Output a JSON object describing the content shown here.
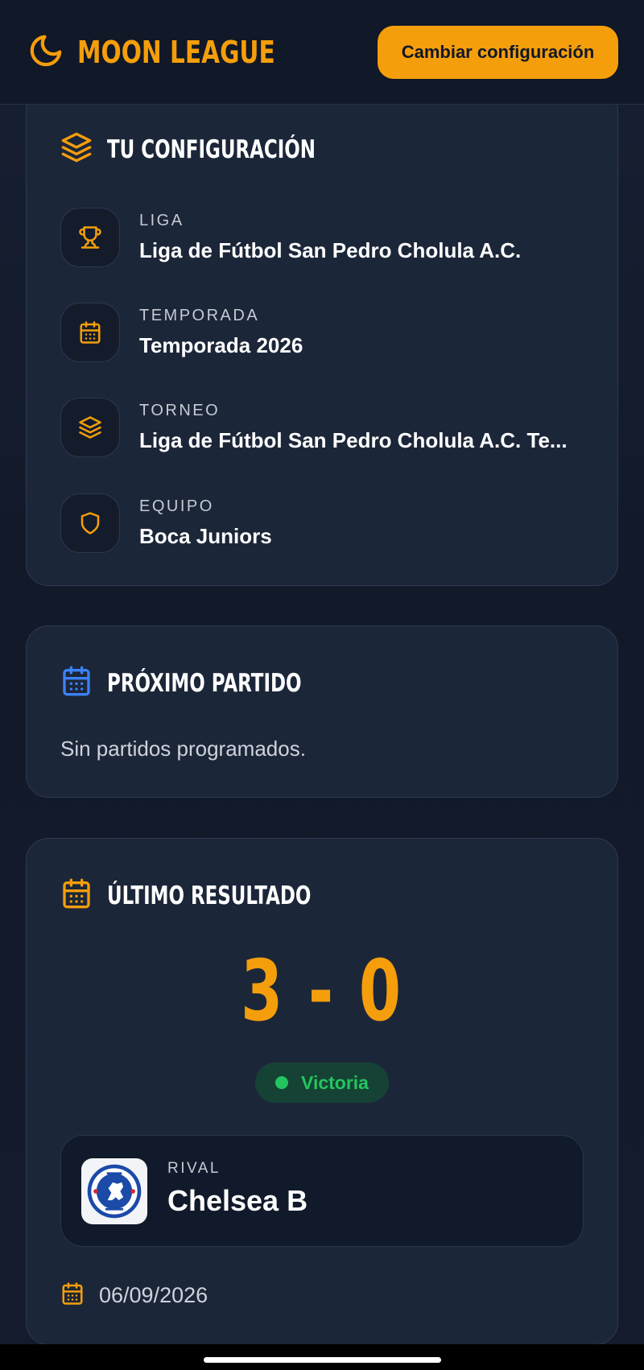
{
  "header": {
    "brand": "MOON LEAGUE",
    "config_button": "Cambiar configuración",
    "brand_icon": "moon-icon"
  },
  "config_card": {
    "title": "TU CONFIGURACIÓN",
    "title_icon": "layers-icon",
    "rows": [
      {
        "label": "LIGA",
        "value": "Liga de Fútbol San Pedro Cholula A.C.",
        "icon": "trophy-icon"
      },
      {
        "label": "TEMPORADA",
        "value": "Temporada 2026",
        "icon": "calendar-icon"
      },
      {
        "label": "TORNEO",
        "value": "Liga de Fútbol San Pedro Cholula A.C. Te...",
        "icon": "layers-icon"
      },
      {
        "label": "EQUIPO",
        "value": "Boca Juniors",
        "icon": "shield-icon"
      }
    ]
  },
  "next_match": {
    "title": "PRÓXIMO PARTIDO",
    "empty": "Sin partidos programados.",
    "icon": "calendar-icon"
  },
  "last_result": {
    "title": "ÚLTIMO RESULTADO",
    "score": "3 - 0",
    "outcome": "Victoria",
    "rival_label": "RIVAL",
    "rival_name": "Chelsea B",
    "rival_crest": "chelsea-crest",
    "date": "06/09/2026",
    "icon": "calendar-icon"
  },
  "colors": {
    "accent": "#f59e0b",
    "background": "#141b2b",
    "card": "#1c2639",
    "win": "#22c55e",
    "info_icon": "#3b82f6"
  }
}
